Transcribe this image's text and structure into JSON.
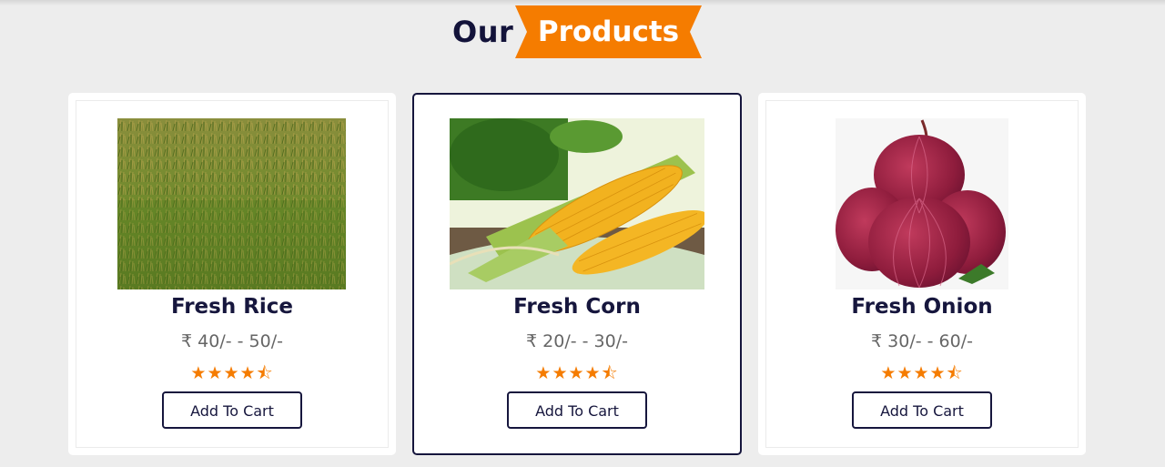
{
  "section": {
    "title_part1": "Our",
    "title_part2": "Products",
    "accent_color": "#f57c00",
    "heading_color": "#16163d"
  },
  "products": [
    {
      "name": "Fresh Rice",
      "price": "₹ 40/- - 50/-",
      "rating": 4.5,
      "button_label": "Add To Cart",
      "image": "rice-field-image"
    },
    {
      "name": "Fresh Corn",
      "price": "₹ 20/- - 30/-",
      "rating": 4.5,
      "button_label": "Add To Cart",
      "image": "corn-cobs-image"
    },
    {
      "name": "Fresh Onion",
      "price": "₹ 30/- - 60/-",
      "rating": 4.5,
      "button_label": "Add To Cart",
      "image": "red-onions-image"
    }
  ]
}
